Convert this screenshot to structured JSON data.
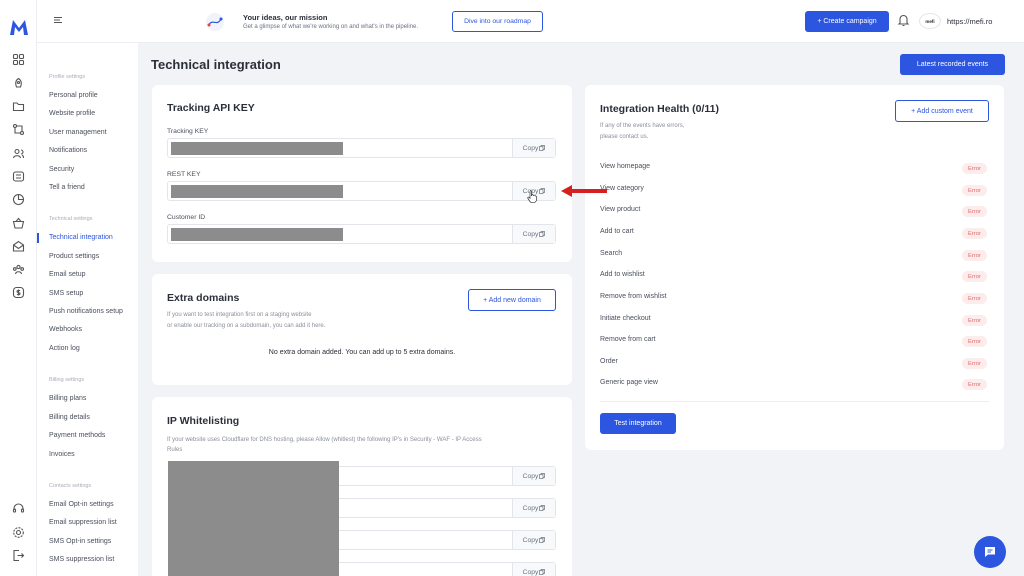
{
  "brand": {
    "logo_letter": "M",
    "accent": "#2c55e0"
  },
  "rail_icons": [
    "dashboard-icon",
    "rocket-icon",
    "folder-icon",
    "flow-icon",
    "contacts-icon",
    "templates-icon",
    "reports-icon",
    "basket-icon",
    "inbox-icon",
    "audience-icon",
    "billing-icon",
    "headset-icon",
    "settings-icon",
    "logout-icon"
  ],
  "topbar": {
    "ideas_title": "Your ideas, our mission",
    "ideas_sub": "Get a glimpse of what we're working on and what's in the pipeline.",
    "roadmap_label": "Dive into our roadmap",
    "create_label": "+ Create campaign",
    "account_logo": "mefi",
    "account_url": "https://mefi.ro"
  },
  "sidebar": {
    "profile_title": "Profile settings",
    "profile": [
      "Personal profile",
      "Website profile",
      "User management",
      "Notifications",
      "Security",
      "Tell a friend"
    ],
    "technical_title": "Technical settings",
    "technical": [
      "Technical integration",
      "Product settings",
      "Email setup",
      "SMS setup",
      "Push notifications setup",
      "Webhooks",
      "Action log"
    ],
    "billing_title": "Billing settings",
    "billing": [
      "Billing plans",
      "Billing details",
      "Payment methods",
      "Invoices"
    ],
    "contacts_title": "Contacts settings",
    "contacts": [
      "Email Opt-in settings",
      "Email suppression list",
      "SMS Opt-in settings",
      "SMS suppression list"
    ]
  },
  "page": {
    "title": "Technical integration",
    "latest_label": "Latest recorded events"
  },
  "api": {
    "title": "Tracking API KEY",
    "tracking_label": "Tracking KEY",
    "rest_label": "REST KEY",
    "customer_label": "Customer ID",
    "copy_label": "Copy"
  },
  "domains": {
    "title": "Extra domains",
    "desc1": "If you want to test integration first on a staging website",
    "desc2": "or enable our tracking on a subdomain, you can add it here.",
    "add_label": "+ Add new domain",
    "empty": "No extra domain added. You can add up to 5 extra domains."
  },
  "whitelist": {
    "title": "IP Whitelisting",
    "desc1": "If your website uses Cloudflare for DNS hosting, please Allow (whitlest) the following IP's in Security - WAF - IP Access",
    "desc2": "Rules",
    "copy_label": "Copy"
  },
  "health": {
    "title": "Integration Health (0/11)",
    "desc1": "If any of the events have errors,",
    "desc2": "please contact us.",
    "add_label": "+ Add custom event",
    "status_label": "Error",
    "events": [
      "View homepage",
      "View category",
      "View product",
      "Add to cart",
      "Search",
      "Add to wishlist",
      "Remove from wishlist",
      "Initiate checkout",
      "Remove from cart",
      "Order",
      "Generic page view"
    ],
    "test_label": "Test integration"
  }
}
